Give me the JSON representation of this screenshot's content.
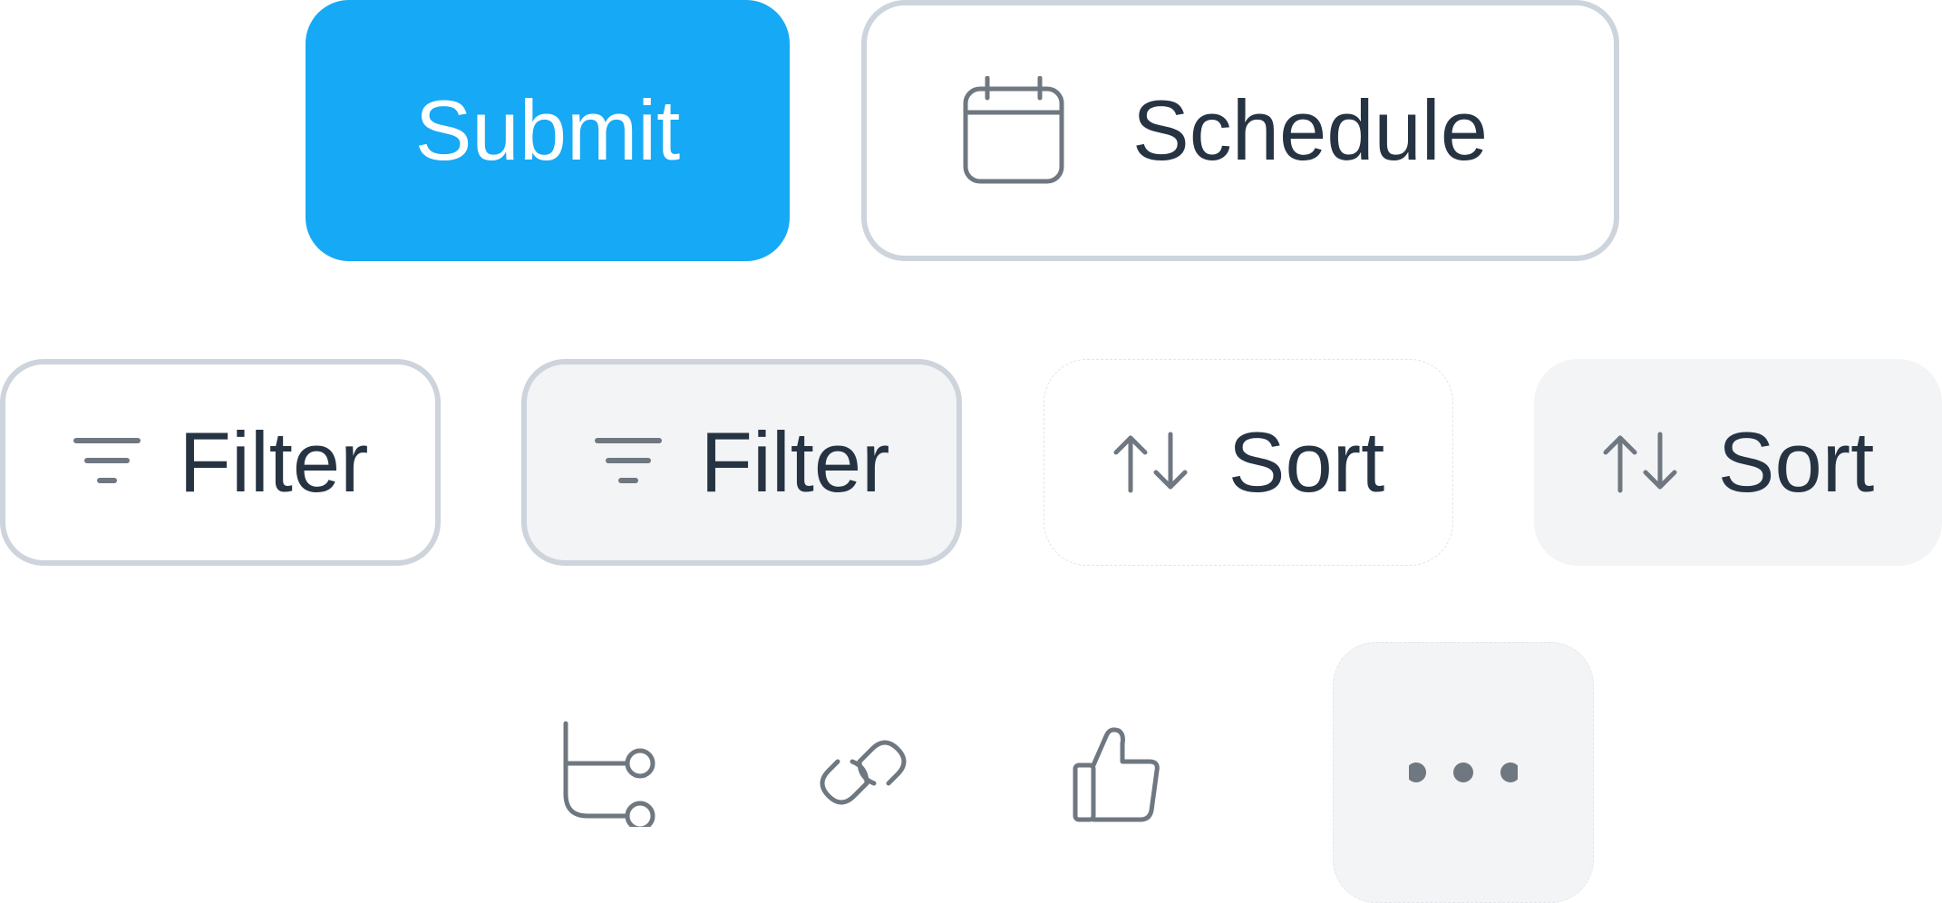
{
  "colors": {
    "primary": "#16a9f5",
    "text": "#263342",
    "icon": "#6f7780",
    "border": "#cdd4dc",
    "muted_bg": "#f3f4f6"
  },
  "row1": {
    "submit_label": "Submit",
    "schedule_label": "Schedule",
    "schedule_icon": "calendar-icon"
  },
  "row2": {
    "filter_outline_label": "Filter",
    "filter_soft_label": "Filter",
    "sort_plain_label": "Sort",
    "sort_soft_label": "Sort",
    "filter_icon": "filter-lines-icon",
    "sort_icon": "sort-arrows-icon"
  },
  "row3": {
    "icons": [
      "branch-icon",
      "link-icon",
      "thumbs-up-icon",
      "more-dots-icon"
    ]
  }
}
